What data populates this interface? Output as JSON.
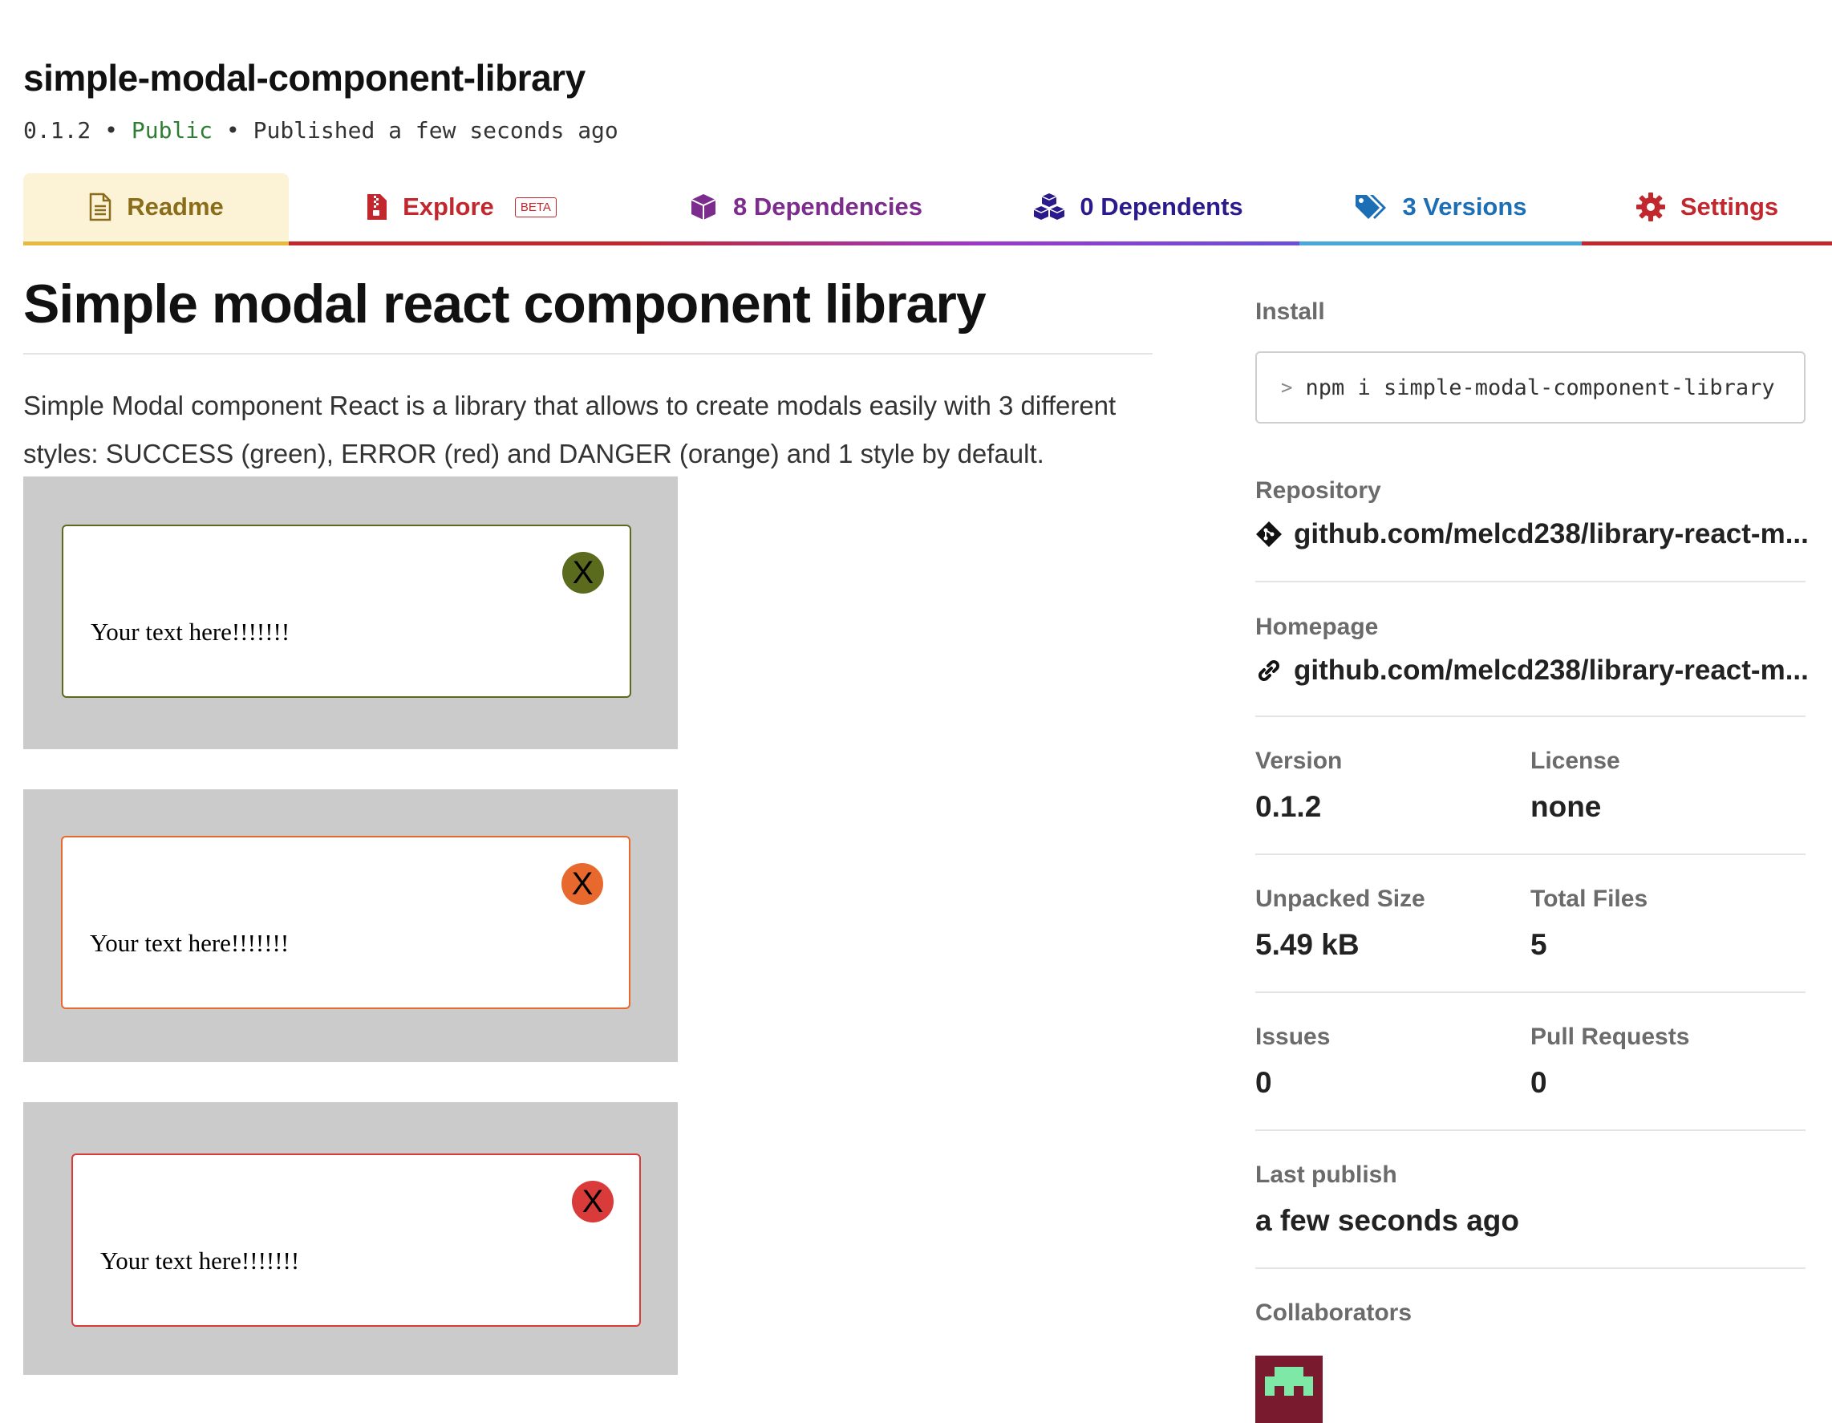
{
  "package": {
    "name": "simple-modal-component-library",
    "version": "0.1.2",
    "separator": "•",
    "visibility": "Public",
    "published": "Published a few seconds ago"
  },
  "tabs": [
    {
      "label": "Readme",
      "icon": "document-icon",
      "color": "#8a6d1a"
    },
    {
      "label": "Explore",
      "icon": "zip-file-icon",
      "badge": "BETA",
      "color": "#c1272d"
    },
    {
      "label": "8 Dependencies",
      "icon": "box-icon",
      "color": "#7b2c8c"
    },
    {
      "label": "0 Dependents",
      "icon": "boxes-icon",
      "color": "#2a1a8c"
    },
    {
      "label": "3 Versions",
      "icon": "tags-icon",
      "color": "#1c6fb4"
    },
    {
      "label": "Settings",
      "icon": "gear-icon",
      "color": "#c1272d"
    }
  ],
  "readme": {
    "heading": "Simple modal react component library",
    "paragraph": "Simple Modal component React is a library that allows to create modals easily with 3 different styles: SUCCESS (green), ERROR (red) and DANGER (orange) and 1 style by default.",
    "demos": [
      {
        "text": "Your text here!!!!!!!",
        "close": "X",
        "accent": "#5a6b1e"
      },
      {
        "text": "Your text here!!!!!!!",
        "close": "X",
        "accent": "#e8692e"
      },
      {
        "text": "Your text here!!!!!!!",
        "close": "X",
        "accent": "#d93a3a"
      }
    ]
  },
  "sidebar": {
    "install_label": "Install",
    "install_prompt": ">",
    "install_command": "npm i simple-modal-component-library",
    "repository_label": "Repository",
    "repository_url": "github.com/melcd238/library-react-m...",
    "homepage_label": "Homepage",
    "homepage_url": "github.com/melcd238/library-react-m...",
    "version_label": "Version",
    "version_value": "0.1.2",
    "license_label": "License",
    "license_value": "none",
    "unpacked_label": "Unpacked Size",
    "unpacked_value": "5.49 kB",
    "files_label": "Total Files",
    "files_value": "5",
    "issues_label": "Issues",
    "issues_value": "0",
    "pulls_label": "Pull Requests",
    "pulls_value": "0",
    "last_publish_label": "Last publish",
    "last_publish_value": "a few seconds ago",
    "collaborators_label": "Collaborators"
  }
}
